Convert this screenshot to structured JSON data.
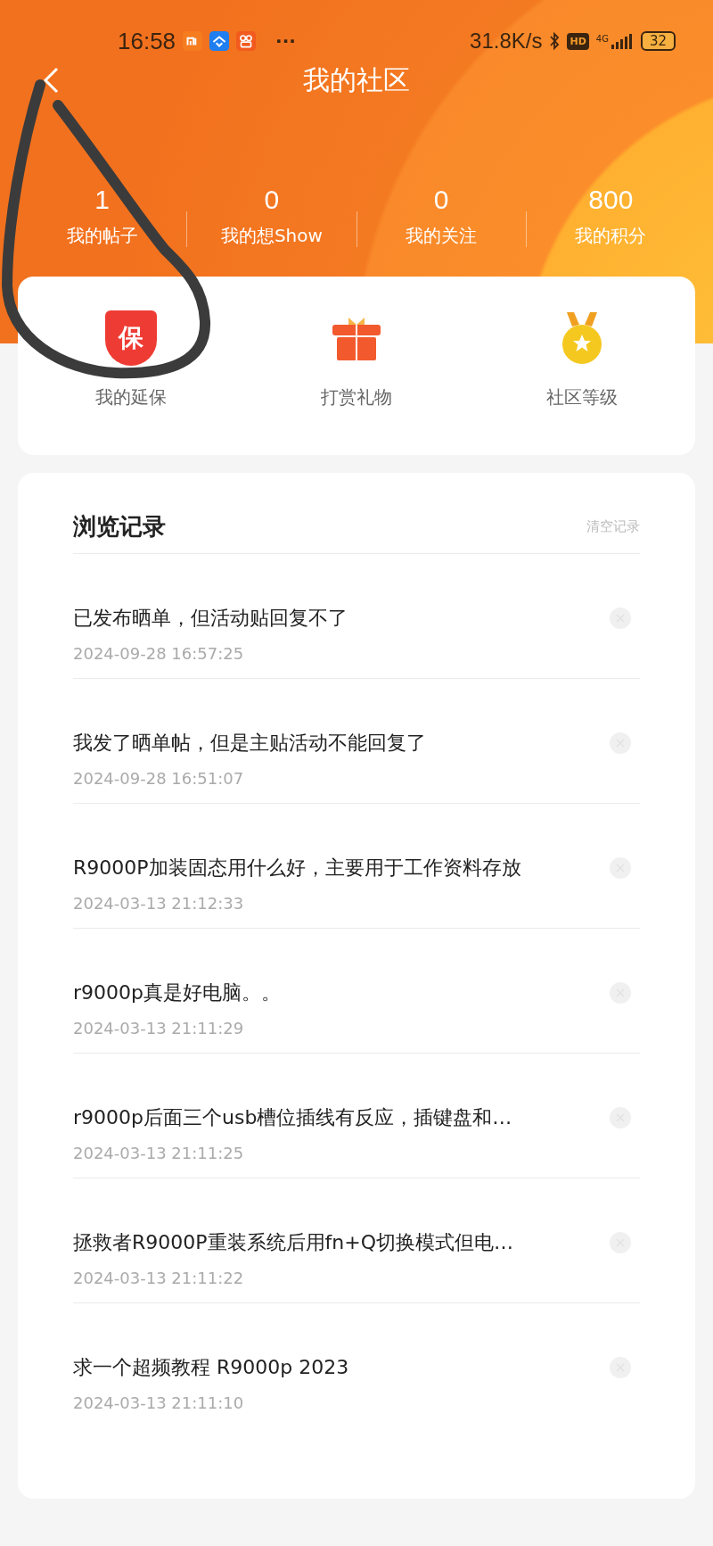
{
  "status_bar": {
    "time": "16:58",
    "more": "···",
    "speed": "31.8K/s",
    "hd": "HD",
    "network": "4G",
    "battery": "32"
  },
  "header": {
    "title": "我的社区"
  },
  "stats": [
    {
      "value": "1",
      "label": "我的帖子"
    },
    {
      "value": "0",
      "label": "我的想Show"
    },
    {
      "value": "0",
      "label": "我的关注"
    },
    {
      "value": "800",
      "label": "我的积分"
    }
  ],
  "shortcuts": [
    {
      "kind": "shield",
      "icon_text": "保",
      "label": "我的延保"
    },
    {
      "kind": "gift",
      "label": "打赏礼物"
    },
    {
      "kind": "medal",
      "label": "社区等级"
    }
  ],
  "history": {
    "title": "浏览记录",
    "clear": "清空记录",
    "items": [
      {
        "title": "已发布晒单，但活动贴回复不了",
        "time": "2024-09-28 16:57:25"
      },
      {
        "title": "我发了晒单帖，但是主贴活动不能回复了",
        "time": "2024-09-28 16:51:07"
      },
      {
        "title": "R9000P加装固态用什么好，主要用于工作资料存放",
        "time": "2024-03-13 21:12:33"
      },
      {
        "title": "r9000p真是好电脑。。",
        "time": "2024-03-13 21:11:29"
      },
      {
        "title": "r9000p后面三个usb槽位插线有反应，插键盘和…",
        "time": "2024-03-13 21:11:25"
      },
      {
        "title": "拯救者R9000P重装系统后用fn+Q切换模式但电…",
        "time": "2024-03-13 21:11:22"
      },
      {
        "title": "求一个超频教程 R9000p 2023",
        "time": "2024-03-13 21:11:10"
      }
    ]
  }
}
